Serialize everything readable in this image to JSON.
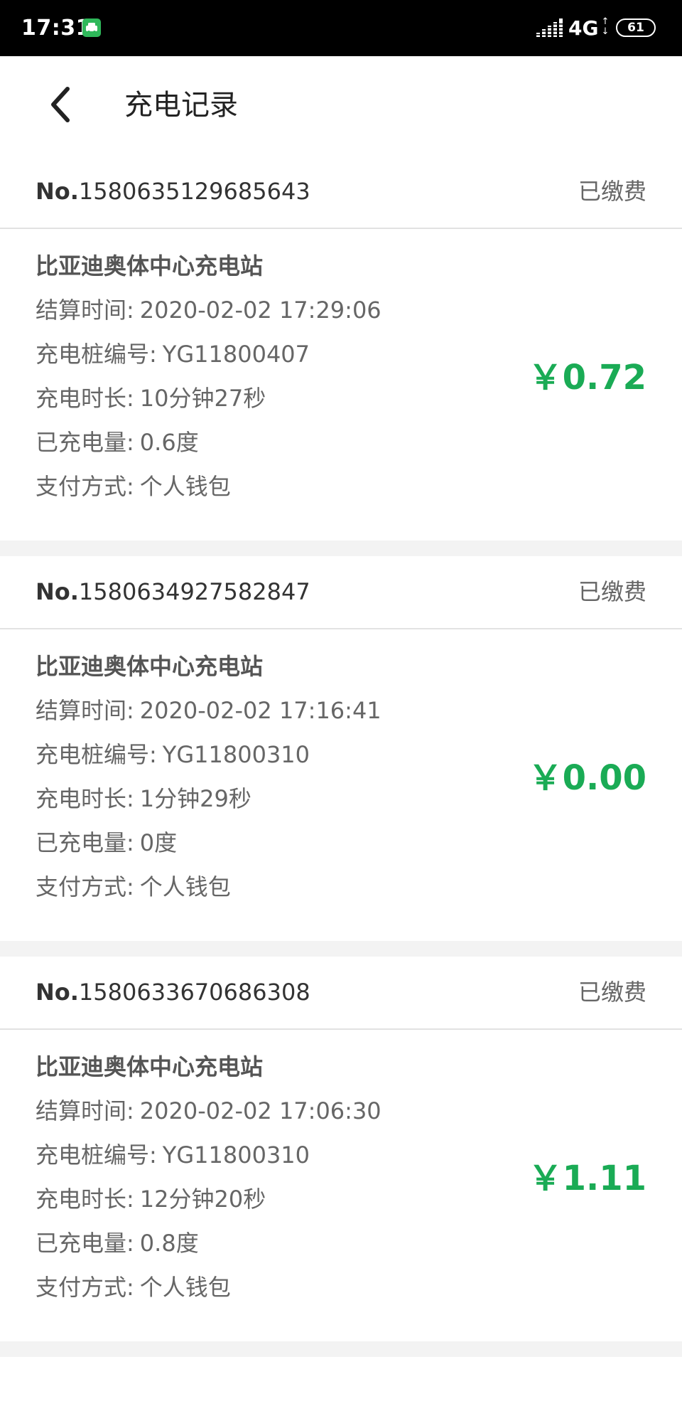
{
  "status_bar": {
    "time": "17:31",
    "network": "4G",
    "battery": "61",
    "app_icon": "car-app-icon",
    "signal_icon": "signal-icon",
    "battery_icon": "battery-icon"
  },
  "header": {
    "back_icon": "chevron-left-icon",
    "title": "充电记录"
  },
  "colors": {
    "amount": "#1aab55",
    "status_bar_bg": "#000000",
    "separator": "#f3f3f3"
  },
  "records": [
    {
      "no_prefix": "No.",
      "no": "1580635129685643",
      "status": "已缴费",
      "station": "比亚迪奥体中心充电站",
      "settle_time_label": "结算时间:",
      "settle_time": "2020-02-02 17:29:06",
      "pile_label": "充电桩编号:",
      "pile": "YG11800407",
      "duration_label": "充电时长:",
      "duration": "10分钟27秒",
      "energy_label": "已充电量:",
      "energy": "0.6度",
      "payment_label": "支付方式:",
      "payment": "个人钱包",
      "amount": "￥0.72"
    },
    {
      "no_prefix": "No.",
      "no": "1580634927582847",
      "status": "已缴费",
      "station": "比亚迪奥体中心充电站",
      "settle_time_label": "结算时间:",
      "settle_time": "2020-02-02 17:16:41",
      "pile_label": "充电桩编号:",
      "pile": "YG11800310",
      "duration_label": "充电时长:",
      "duration": "1分钟29秒",
      "energy_label": "已充电量:",
      "energy": "0度",
      "payment_label": "支付方式:",
      "payment": "个人钱包",
      "amount": "￥0.00"
    },
    {
      "no_prefix": "No.",
      "no": "1580633670686308",
      "status": "已缴费",
      "station": "比亚迪奥体中心充电站",
      "settle_time_label": "结算时间:",
      "settle_time": "2020-02-02 17:06:30",
      "pile_label": "充电桩编号:",
      "pile": "YG11800310",
      "duration_label": "充电时长:",
      "duration": "12分钟20秒",
      "energy_label": "已充电量:",
      "energy": "0.8度",
      "payment_label": "支付方式:",
      "payment": "个人钱包",
      "amount": "￥1.11"
    }
  ]
}
